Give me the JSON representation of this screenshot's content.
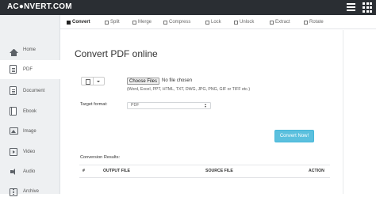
{
  "header": {
    "logo": "AC●NVERT.COM",
    "menu_icon": "hamburger-icon",
    "apps_icon": "grid-icon"
  },
  "sidebar": {
    "items": [
      {
        "label": "Home",
        "icon": "home-icon",
        "active": false
      },
      {
        "label": "PDF",
        "icon": "pdf-icon",
        "active": true
      },
      {
        "label": "Document",
        "icon": "document-icon",
        "active": false
      },
      {
        "label": "Ebook",
        "icon": "ebook-icon",
        "active": false
      },
      {
        "label": "Image",
        "icon": "image-icon",
        "active": false
      },
      {
        "label": "Video",
        "icon": "video-icon",
        "active": false
      },
      {
        "label": "Audio",
        "icon": "audio-icon",
        "active": false
      },
      {
        "label": "Archive",
        "icon": "archive-icon",
        "active": false
      }
    ]
  },
  "tabs": [
    {
      "label": "Convert",
      "active": true
    },
    {
      "label": "Split",
      "active": false
    },
    {
      "label": "Merge",
      "active": false
    },
    {
      "label": "Compress",
      "active": false
    },
    {
      "label": "Lock",
      "active": false
    },
    {
      "label": "Unlock",
      "active": false
    },
    {
      "label": "Extract",
      "active": false
    },
    {
      "label": "Rotate",
      "active": false
    }
  ],
  "main": {
    "title": "Convert PDF online",
    "choose_files_label": "Choose Files",
    "no_file_text": "No file chosen",
    "formats_hint": "(Word, Excel, PPT, HTML, TXT, DWG, JPG, PNG, GIF or TIFF etc.)",
    "target_format_label": "Target format:",
    "target_format_value": "PDF",
    "convert_button": "Convert Now!",
    "results_label": "Conversion Results:",
    "results_columns": [
      "#",
      "OUTPUT FILE",
      "SOURCE FILE",
      "ACTION"
    ]
  },
  "colors": {
    "topbar": "#2a2e33",
    "accent_button": "#5bc0de",
    "sidebar_bg": "#eef0f2"
  }
}
